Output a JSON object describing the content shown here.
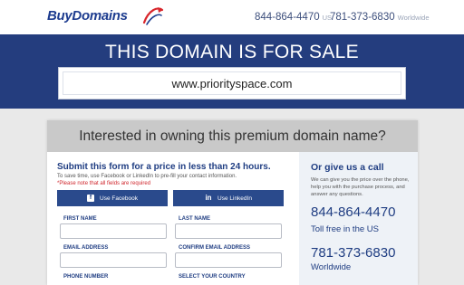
{
  "header": {
    "logo": "BuyDomains",
    "phones": [
      {
        "number": "844-864-4470",
        "location": "US"
      },
      {
        "number": "781-373-6830",
        "location": "Worldwide"
      }
    ]
  },
  "banner": {
    "title": "THIS DOMAIN IS FOR SALE",
    "domain": "www.priorityspace.com"
  },
  "panel": {
    "heading": "Interested in owning this premium domain name?",
    "form": {
      "title": "Submit this form for a price in less than 24 hours.",
      "subtitle": "To save time, use Facebook or LinkedIn to pre-fill your contact information.",
      "required_note": "*Please note that all fields are required",
      "facebook_label": "Use Facebook",
      "linkedin_label": "Use LinkedIn",
      "fields": {
        "first_name": "FIRST NAME",
        "last_name": "LAST NAME",
        "email": "EMAIL ADDRESS",
        "confirm_email": "CONFIRM EMAIL ADDRESS",
        "phone": "PHONE NUMBER",
        "country": "SELECT YOUR COUNTRY"
      }
    },
    "side": {
      "title": "Or give us a call",
      "description": "We can give you the price over the phone, help you with the purchase process, and answer any questions.",
      "phone_us": "844-864-4470",
      "phone_us_note": "Toll free in the US",
      "phone_world": "781-373-6830",
      "phone_world_note": "Worldwide"
    }
  },
  "colors": {
    "brand_blue": "#243d7e",
    "heading_blue": "#1f3d82",
    "button_blue": "#2a4a8c",
    "required_red": "#d0282e"
  }
}
